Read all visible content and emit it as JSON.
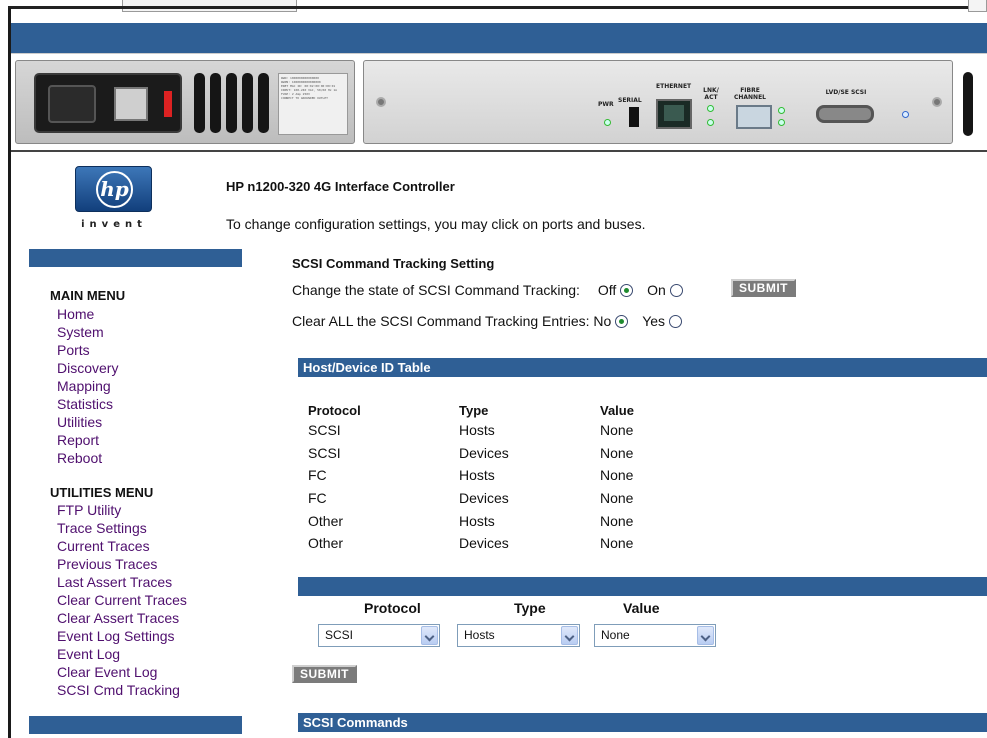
{
  "window": {
    "address_field": ""
  },
  "hardware_panel": {
    "label_lines": [
      "WWN: 1000000000000000",
      "WWPN: 1000000000000000",
      "ENET MAC ID: 00:02:00:00:00:01",
      "INPUT: 100-240 VAC, 50/60 Hz 1A",
      "FUSE: 2 Amp 250V",
      "CONNECT TO GROUNDED OUTLET"
    ],
    "pwr": "PWR",
    "serial": "SERIAL",
    "ethernet": "ETHERNET",
    "lnk_act": "LNK/ ACT",
    "fibre_channel": "FIBRE CHANNEL",
    "lvd_se_scsi": "LVD/SE SCSI"
  },
  "logo": {
    "mark": "hp",
    "tagline": "invent"
  },
  "header": {
    "title": "HP n1200-320 4G Interface Controller",
    "subtitle": "To change configuration settings, you may click on ports and buses."
  },
  "main_menu": {
    "heading": "MAIN MENU",
    "items": [
      "Home",
      "System",
      "Ports",
      "Discovery",
      "Mapping",
      "Statistics",
      "Utilities",
      "Report",
      "Reboot"
    ]
  },
  "utilities_menu": {
    "heading": "UTILITIES MENU",
    "items": [
      "FTP Utility",
      "Trace Settings",
      "Current Traces",
      "Previous Traces",
      "Last Assert Traces",
      "Clear Current Traces",
      "Clear Assert Traces",
      "Event Log Settings",
      "Event Log",
      "Clear Event Log",
      "SCSI Cmd Tracking"
    ]
  },
  "tracking": {
    "title": "SCSI Command Tracking Setting",
    "state_label": "Change the state of SCSI Command Tracking:",
    "off_label": "Off",
    "on_label": "On",
    "state_selected": "Off",
    "submit_label": "SUBMIT",
    "clear_label": "Clear ALL the SCSI Command Tracking Entries:",
    "no_label": "No",
    "yes_label": "Yes",
    "clear_selected": "No"
  },
  "host_device_table": {
    "title": "Host/Device ID Table",
    "headers": [
      "Protocol",
      "Type",
      "Value"
    ],
    "rows": [
      [
        "SCSI",
        "Hosts",
        "None"
      ],
      [
        "SCSI",
        "Devices",
        "None"
      ],
      [
        "FC",
        "Hosts",
        "None"
      ],
      [
        "FC",
        "Devices",
        "None"
      ],
      [
        "Other",
        "Hosts",
        "None"
      ],
      [
        "Other",
        "Devices",
        "None"
      ]
    ]
  },
  "selector": {
    "protocol_label": "Protocol",
    "type_label": "Type",
    "value_label": "Value",
    "protocol_value": "SCSI",
    "type_value": "Hosts",
    "value_value": "None",
    "submit_label": "SUBMIT"
  },
  "scsi_commands": {
    "title": "SCSI Commands"
  },
  "colors": {
    "bar_blue": "#2f5f95",
    "link_purple": "#4f0f6e",
    "button_grey": "#7b7b7b"
  }
}
